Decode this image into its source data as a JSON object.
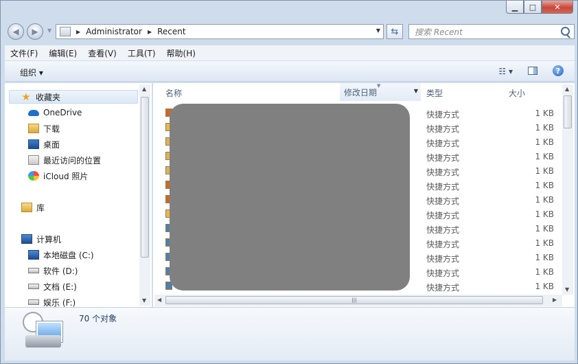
{
  "window": {
    "caption_buttons": {
      "minimize": "▁",
      "maximize": "□",
      "close": "✕"
    }
  },
  "navigation": {
    "back_icon": "back-arrow-icon",
    "forward_icon": "forward-arrow-icon",
    "breadcrumb": [
      "Administrator",
      "Recent"
    ],
    "search_placeholder": "搜索 Recent"
  },
  "menubar": {
    "items": [
      "文件(F)",
      "编辑(E)",
      "查看(V)",
      "工具(T)",
      "帮助(H)"
    ]
  },
  "commandbar": {
    "organize_label": "组织 ▾",
    "view_label": "☷ ▾"
  },
  "navpane": {
    "favorites_label": "收藏夹",
    "favorites": [
      "OneDrive",
      "下载",
      "桌面",
      "最近访问的位置",
      "iCloud 照片"
    ],
    "libraries_label": "库",
    "computer_label": "计算机",
    "drives": [
      "本地磁盘 (C:)",
      "软件 (D:)",
      "文档 (E:)",
      "娱乐 (F:)"
    ]
  },
  "filelist": {
    "columns": [
      "名称",
      "修改日期",
      "类型",
      "大小"
    ],
    "sorted_column": "修改日期",
    "rows": [
      {
        "type": "快捷方式",
        "size": "1 KB"
      },
      {
        "type": "快捷方式",
        "size": "1 KB"
      },
      {
        "type": "快捷方式",
        "size": "1 KB"
      },
      {
        "type": "快捷方式",
        "size": "1 KB"
      },
      {
        "type": "快捷方式",
        "size": "1 KB"
      },
      {
        "type": "快捷方式",
        "size": "1 KB"
      },
      {
        "type": "快捷方式",
        "size": "1 KB"
      },
      {
        "type": "快捷方式",
        "size": "1 KB"
      },
      {
        "type": "快捷方式",
        "size": "1 KB"
      },
      {
        "type": "快捷方式",
        "size": "1 KB"
      },
      {
        "type": "快捷方式",
        "size": "1 KB"
      },
      {
        "type": "快捷方式",
        "size": "1 KB"
      },
      {
        "type": "快捷方式",
        "size": "1 KB"
      }
    ]
  },
  "details": {
    "item_count": "70 个对象"
  }
}
